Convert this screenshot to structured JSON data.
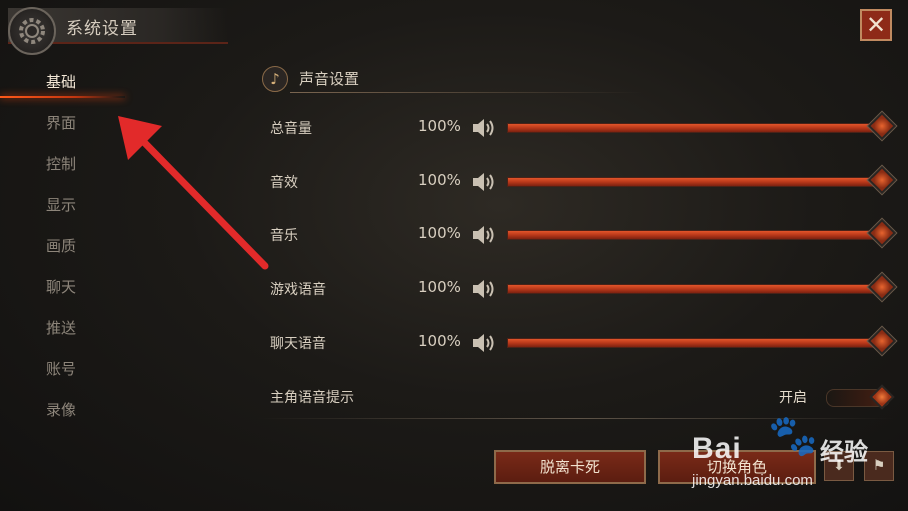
{
  "window": {
    "title": "系统设置"
  },
  "sidebar": {
    "items": [
      {
        "label": "基础",
        "active": true
      },
      {
        "label": "界面",
        "active": false
      },
      {
        "label": "控制",
        "active": false
      },
      {
        "label": "显示",
        "active": false
      },
      {
        "label": "画质",
        "active": false
      },
      {
        "label": "聊天",
        "active": false
      },
      {
        "label": "推送",
        "active": false
      },
      {
        "label": "账号",
        "active": false
      },
      {
        "label": "录像",
        "active": false
      }
    ]
  },
  "section": {
    "title": "声音设置",
    "icon": "music-note-icon"
  },
  "volume_rows": [
    {
      "label": "总音量",
      "percent_text": "100%",
      "value": 1.0
    },
    {
      "label": "音效",
      "percent_text": "100%",
      "value": 1.0
    },
    {
      "label": "音乐",
      "percent_text": "100%",
      "value": 1.0
    },
    {
      "label": "游戏语音",
      "percent_text": "100%",
      "value": 1.0
    },
    {
      "label": "聊天语音",
      "percent_text": "100%",
      "value": 1.0
    }
  ],
  "toggle_row": {
    "label": "主角语音提示",
    "state_text": "开启",
    "on": true
  },
  "buttons": {
    "unstuck": "脱离卡死",
    "switch_character": "切换角色"
  },
  "small_buttons": [
    {
      "icon": "download-icon"
    },
    {
      "icon": "flag-icon",
      "text": "🏴"
    }
  ],
  "watermark": {
    "brand": "Bai",
    "cn": "经验",
    "url": "jingyan.baidu.com"
  },
  "colors": {
    "accent": "#c2360f",
    "slider_fill": "#b8381a",
    "close_bg": "#8e2a18"
  }
}
